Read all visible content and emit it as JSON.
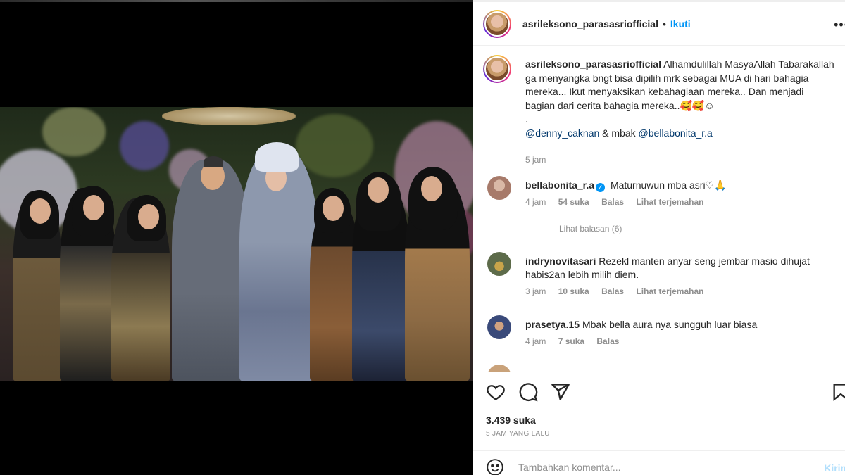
{
  "post": {
    "author": "asrileksono_parasasriofficial",
    "follow_label": "Ikuti",
    "header_separator": "•",
    "more_icon": "more-horizontal-icon",
    "caption": {
      "username": "asrileksono_parasasriofficial",
      "text": "Alhamdulillah MasyaAllah Tabarakallah ga menyangka bngt bisa dipilih mrk sebagai MUA di hari bahagia mereka... Ikut menyaksikan kebahagiaan mereka.. Dan menjadi bagian dari cerita bahagia mereka..🥰🥰☺",
      "dot": ".",
      "mention_1": "@denny_caknan",
      "connector": " & mbak ",
      "mention_2": "@bellabonita_r.a",
      "time": "5 jam"
    },
    "comments": [
      {
        "username": "bellabonita_r.a",
        "verified": true,
        "text": "Maturnuwun mba asri♡🙏",
        "time": "4 jam",
        "likes": "54 suka",
        "reply_label": "Balas",
        "translate_label": "Lihat terjemahan",
        "avatar_color": "#a77a6a"
      },
      {
        "username": "indrynovitasari",
        "verified": false,
        "text": "Rezekl manten anyar seng jembar masio dihujat habis2an lebih milih diem.",
        "time": "3 jam",
        "likes": "10 suka",
        "reply_label": "Balas",
        "translate_label": "Lihat terjemahan",
        "avatar_color": "#5d6b4a"
      },
      {
        "username": "prasetya.15",
        "verified": false,
        "text": "Mbak bella aura nya sungguh luar biasa",
        "time": "4 jam",
        "likes": "7 suka",
        "reply_label": "Balas",
        "translate_label": "",
        "avatar_color": "#3a4a7a"
      }
    ],
    "view_replies": "Lihat balasan (6)",
    "likes": "3.439 suka",
    "time_ago": "5 JAM YANG LALU",
    "comment_placeholder": "Tambahkan komentar...",
    "post_button": "Kirim"
  },
  "icons": {
    "like": "heart-icon",
    "comment": "comment-icon",
    "share": "send-icon",
    "save": "bookmark-icon",
    "emoji": "smiley-icon"
  },
  "colors": {
    "accent": "#0095f6",
    "mention": "#00376b",
    "muted": "#8e8e8e"
  }
}
